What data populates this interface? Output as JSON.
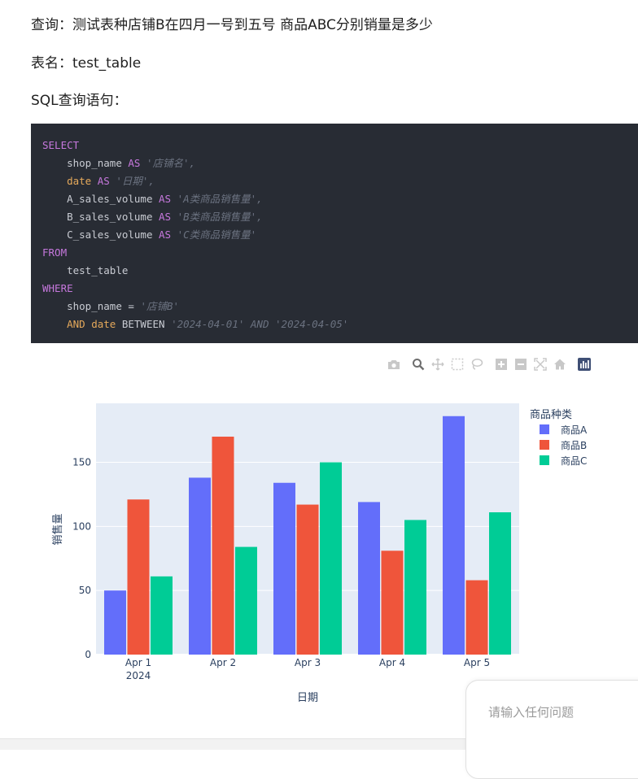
{
  "question": {
    "query_line": "查询：测试表种店铺B在四月一号到五号 商品ABC分别销量是多少",
    "table_line": "表名：test_table",
    "sql_label": "SQL查询语句："
  },
  "sql": {
    "select": "SELECT",
    "col1": "shop_name",
    "as": "AS",
    "alias1": "'店铺名',",
    "col2": "date",
    "alias2": "'日期',",
    "col3": "A_sales_volume",
    "alias3": "'A类商品销售量',",
    "col4": "B_sales_volume",
    "alias4": "'B类商品销售量',",
    "col5": "C_sales_volume",
    "alias5": "'C类商品销售量'",
    "from": "FROM",
    "table": "test_table",
    "where": "WHERE",
    "cond1_col": "shop_name",
    "cond1_op": "=",
    "cond1_val": "'店铺B'",
    "and": "AND",
    "cond2_col": "date",
    "between": "BETWEEN",
    "cond2_range": "'2024-04-01' AND '2024-04-05'"
  },
  "modebar": [
    "camera-icon",
    "zoom-icon",
    "pan-icon",
    "box-select-icon",
    "lasso-icon",
    "zoom-in-icon",
    "zoom-out-icon",
    "autoscale-icon",
    "home-icon",
    "plotly-logo-icon"
  ],
  "chart_data": {
    "type": "bar",
    "categories": [
      "Apr 1",
      "Apr 2",
      "Apr 3",
      "Apr 4",
      "Apr 5"
    ],
    "year_label": "2024",
    "series": [
      {
        "name": "商品A",
        "color": "#636efa",
        "values": [
          50,
          138,
          134,
          119,
          186
        ]
      },
      {
        "name": "商品B",
        "color": "#ef553b",
        "values": [
          121,
          170,
          117,
          81,
          58
        ]
      },
      {
        "name": "商品C",
        "color": "#00cc96",
        "values": [
          61,
          84,
          150,
          105,
          111
        ]
      }
    ],
    "xlabel": "日期",
    "ylabel": "销售量",
    "legend_title": "商品种类",
    "ylim": [
      0,
      196
    ],
    "yticks": [
      0,
      50,
      100,
      150
    ],
    "grid": true,
    "legend_position": "top-right"
  },
  "input": {
    "placeholder": "请输入任何问题"
  }
}
